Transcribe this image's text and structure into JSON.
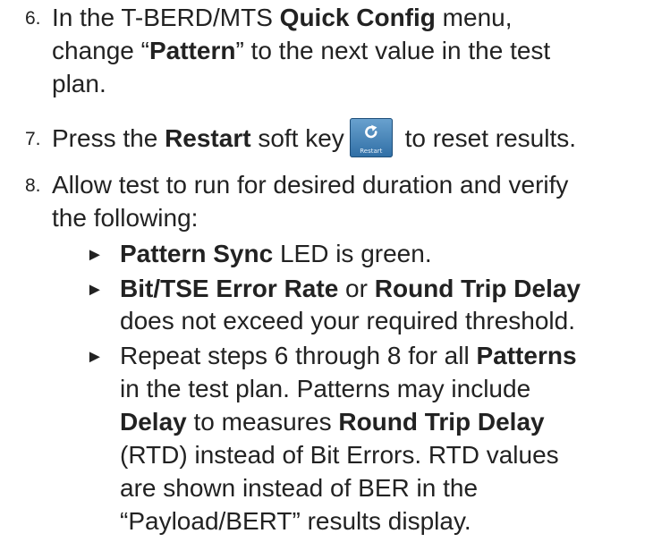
{
  "steps": [
    {
      "number": "6.",
      "lines": [
        [
          "In the T-BERD/MTS ",
          "Quick Config",
          " menu,"
        ],
        [
          "change “",
          "Pattern",
          "” to the next value in the test"
        ],
        [
          "plan."
        ]
      ]
    },
    {
      "number": "7.",
      "lines": [
        [
          "Press the ",
          "Restart",
          " soft key",
          " to reset results."
        ]
      ],
      "soft_key_label": "Restart",
      "soft_key_icon": "restart-icon",
      "soft_key_color": "#3d7fb7"
    },
    {
      "number": "8.",
      "lines": [
        [
          "Allow test to run for desired duration and verify"
        ],
        [
          "the following:"
        ]
      ],
      "bullets": [
        {
          "lines": [
            [
              "",
              "Pattern Sync",
              " LED is green."
            ]
          ]
        },
        {
          "lines": [
            [
              "",
              "Bit/TSE Error Rate",
              " or ",
              "Round Trip Delay"
            ],
            [
              "does not exceed your required threshold."
            ]
          ]
        },
        {
          "lines": [
            [
              "Repeat steps 6 through 8 for all ",
              "Patterns"
            ],
            [
              "in the test plan.  Patterns may include"
            ],
            [
              "",
              "Delay",
              " to measures ",
              "Round Trip Delay"
            ],
            [
              "(RTD) instead of Bit Errors.  RTD values"
            ],
            [
              "are shown instead of BER in the"
            ],
            [
              "“Payload/BERT” results display."
            ]
          ]
        }
      ]
    }
  ],
  "bullet_glyph": "►"
}
